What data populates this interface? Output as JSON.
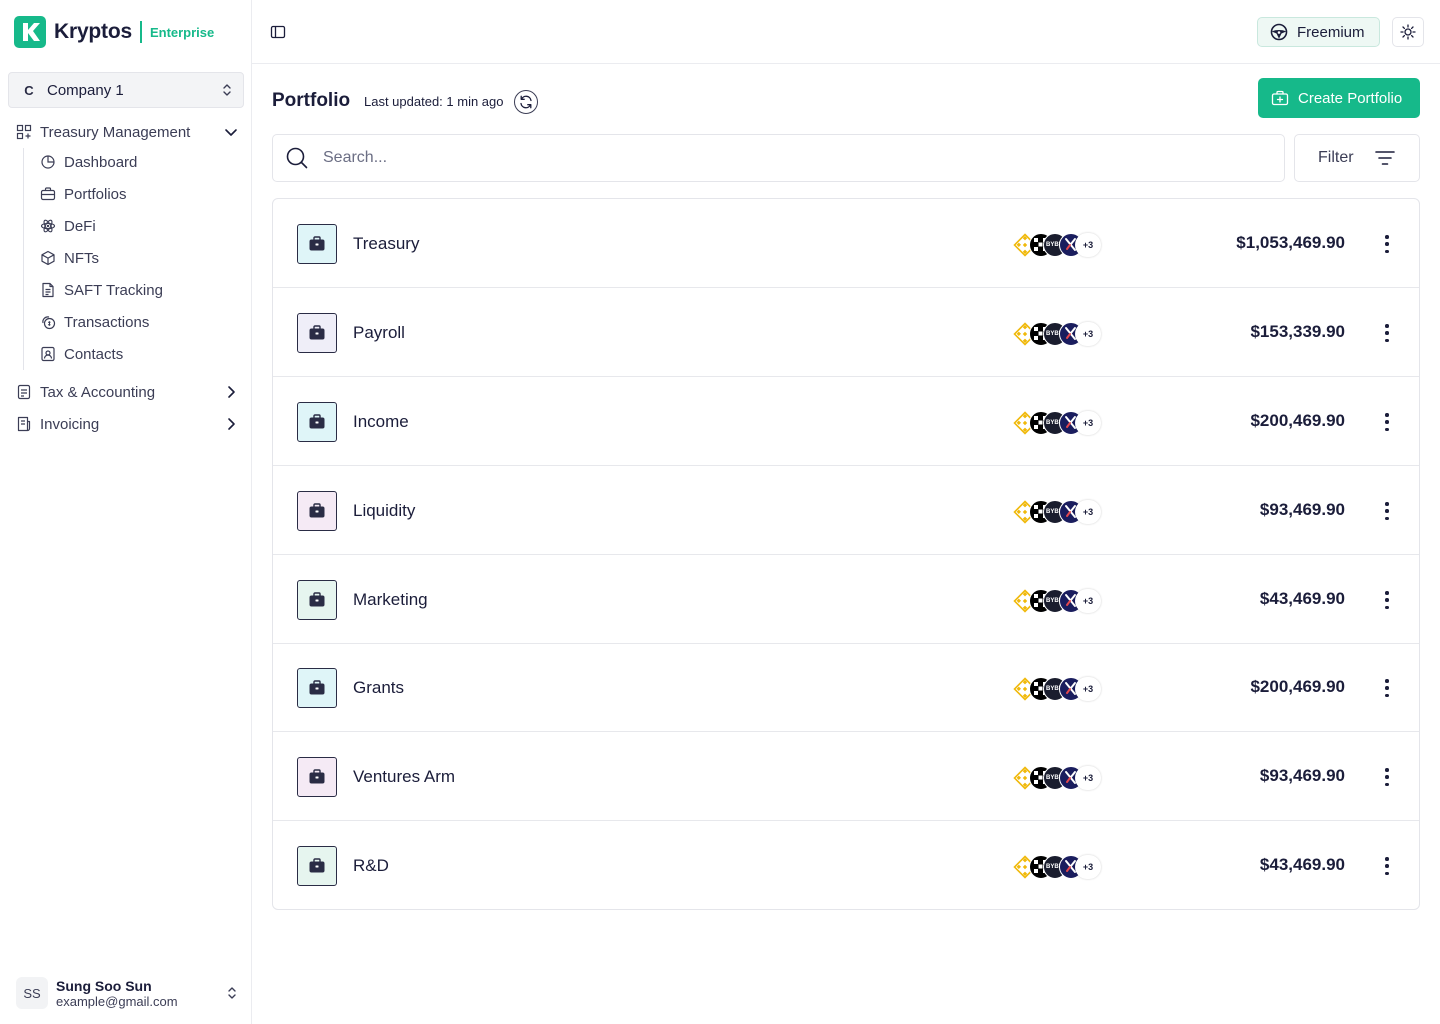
{
  "brand": {
    "name": "Kryptos",
    "tier": "Enterprise"
  },
  "company": {
    "badge": "C",
    "name": "Company 1"
  },
  "sidebar": {
    "groups": [
      {
        "label": "Treasury Management",
        "icon": "grid-plus-icon",
        "expanded": true
      },
      {
        "label": "Tax & Accounting",
        "icon": "receipt-icon",
        "expanded": false
      },
      {
        "label": "Invoicing",
        "icon": "invoice-icon",
        "expanded": false
      }
    ],
    "items": [
      {
        "label": "Dashboard",
        "icon": "pie-chart-icon"
      },
      {
        "label": "Portfolios",
        "icon": "briefcase-icon"
      },
      {
        "label": "DeFi",
        "icon": "atom-icon"
      },
      {
        "label": "NFTs",
        "icon": "cube-icon"
      },
      {
        "label": "SAFT Tracking",
        "icon": "document-icon"
      },
      {
        "label": "Transactions",
        "icon": "coins-icon"
      },
      {
        "label": "Contacts",
        "icon": "contact-icon"
      }
    ]
  },
  "user": {
    "initials": "SS",
    "name": "Sung Soo Sun",
    "email": "example@gmail.com"
  },
  "topbar": {
    "plan": "Freemium"
  },
  "main": {
    "title": "Portfolio",
    "updated": "Last updated: 1 min ago",
    "create_label": "Create Portfolio",
    "search_placeholder": "Search...",
    "filter_label": "Filter"
  },
  "coins": {
    "bybit_label": "BYBIT",
    "more": "+3"
  },
  "portfolios": [
    {
      "name": "Treasury",
      "amount": "$1,053,469.90",
      "icon_bg": "#dff5f8"
    },
    {
      "name": "Payroll",
      "amount": "$153,339.90",
      "icon_bg": "#efeef8"
    },
    {
      "name": "Income",
      "amount": "$200,469.90",
      "icon_bg": "#dff5f8"
    },
    {
      "name": "Liquidity",
      "amount": "$93,469.90",
      "icon_bg": "#f5eaf5"
    },
    {
      "name": "Marketing",
      "amount": "$43,469.90",
      "icon_bg": "#e6f5ef"
    },
    {
      "name": "Grants",
      "amount": "$200,469.90",
      "icon_bg": "#dff5f8"
    },
    {
      "name": "Ventures Arm",
      "amount": "$93,469.90",
      "icon_bg": "#f5eaf5"
    },
    {
      "name": "R&D",
      "amount": "$43,469.90",
      "icon_bg": "#e6f5ef"
    }
  ],
  "colors": {
    "accent": "#16b98a",
    "text": "#1b1d3a",
    "border": "#e4e5ea"
  }
}
